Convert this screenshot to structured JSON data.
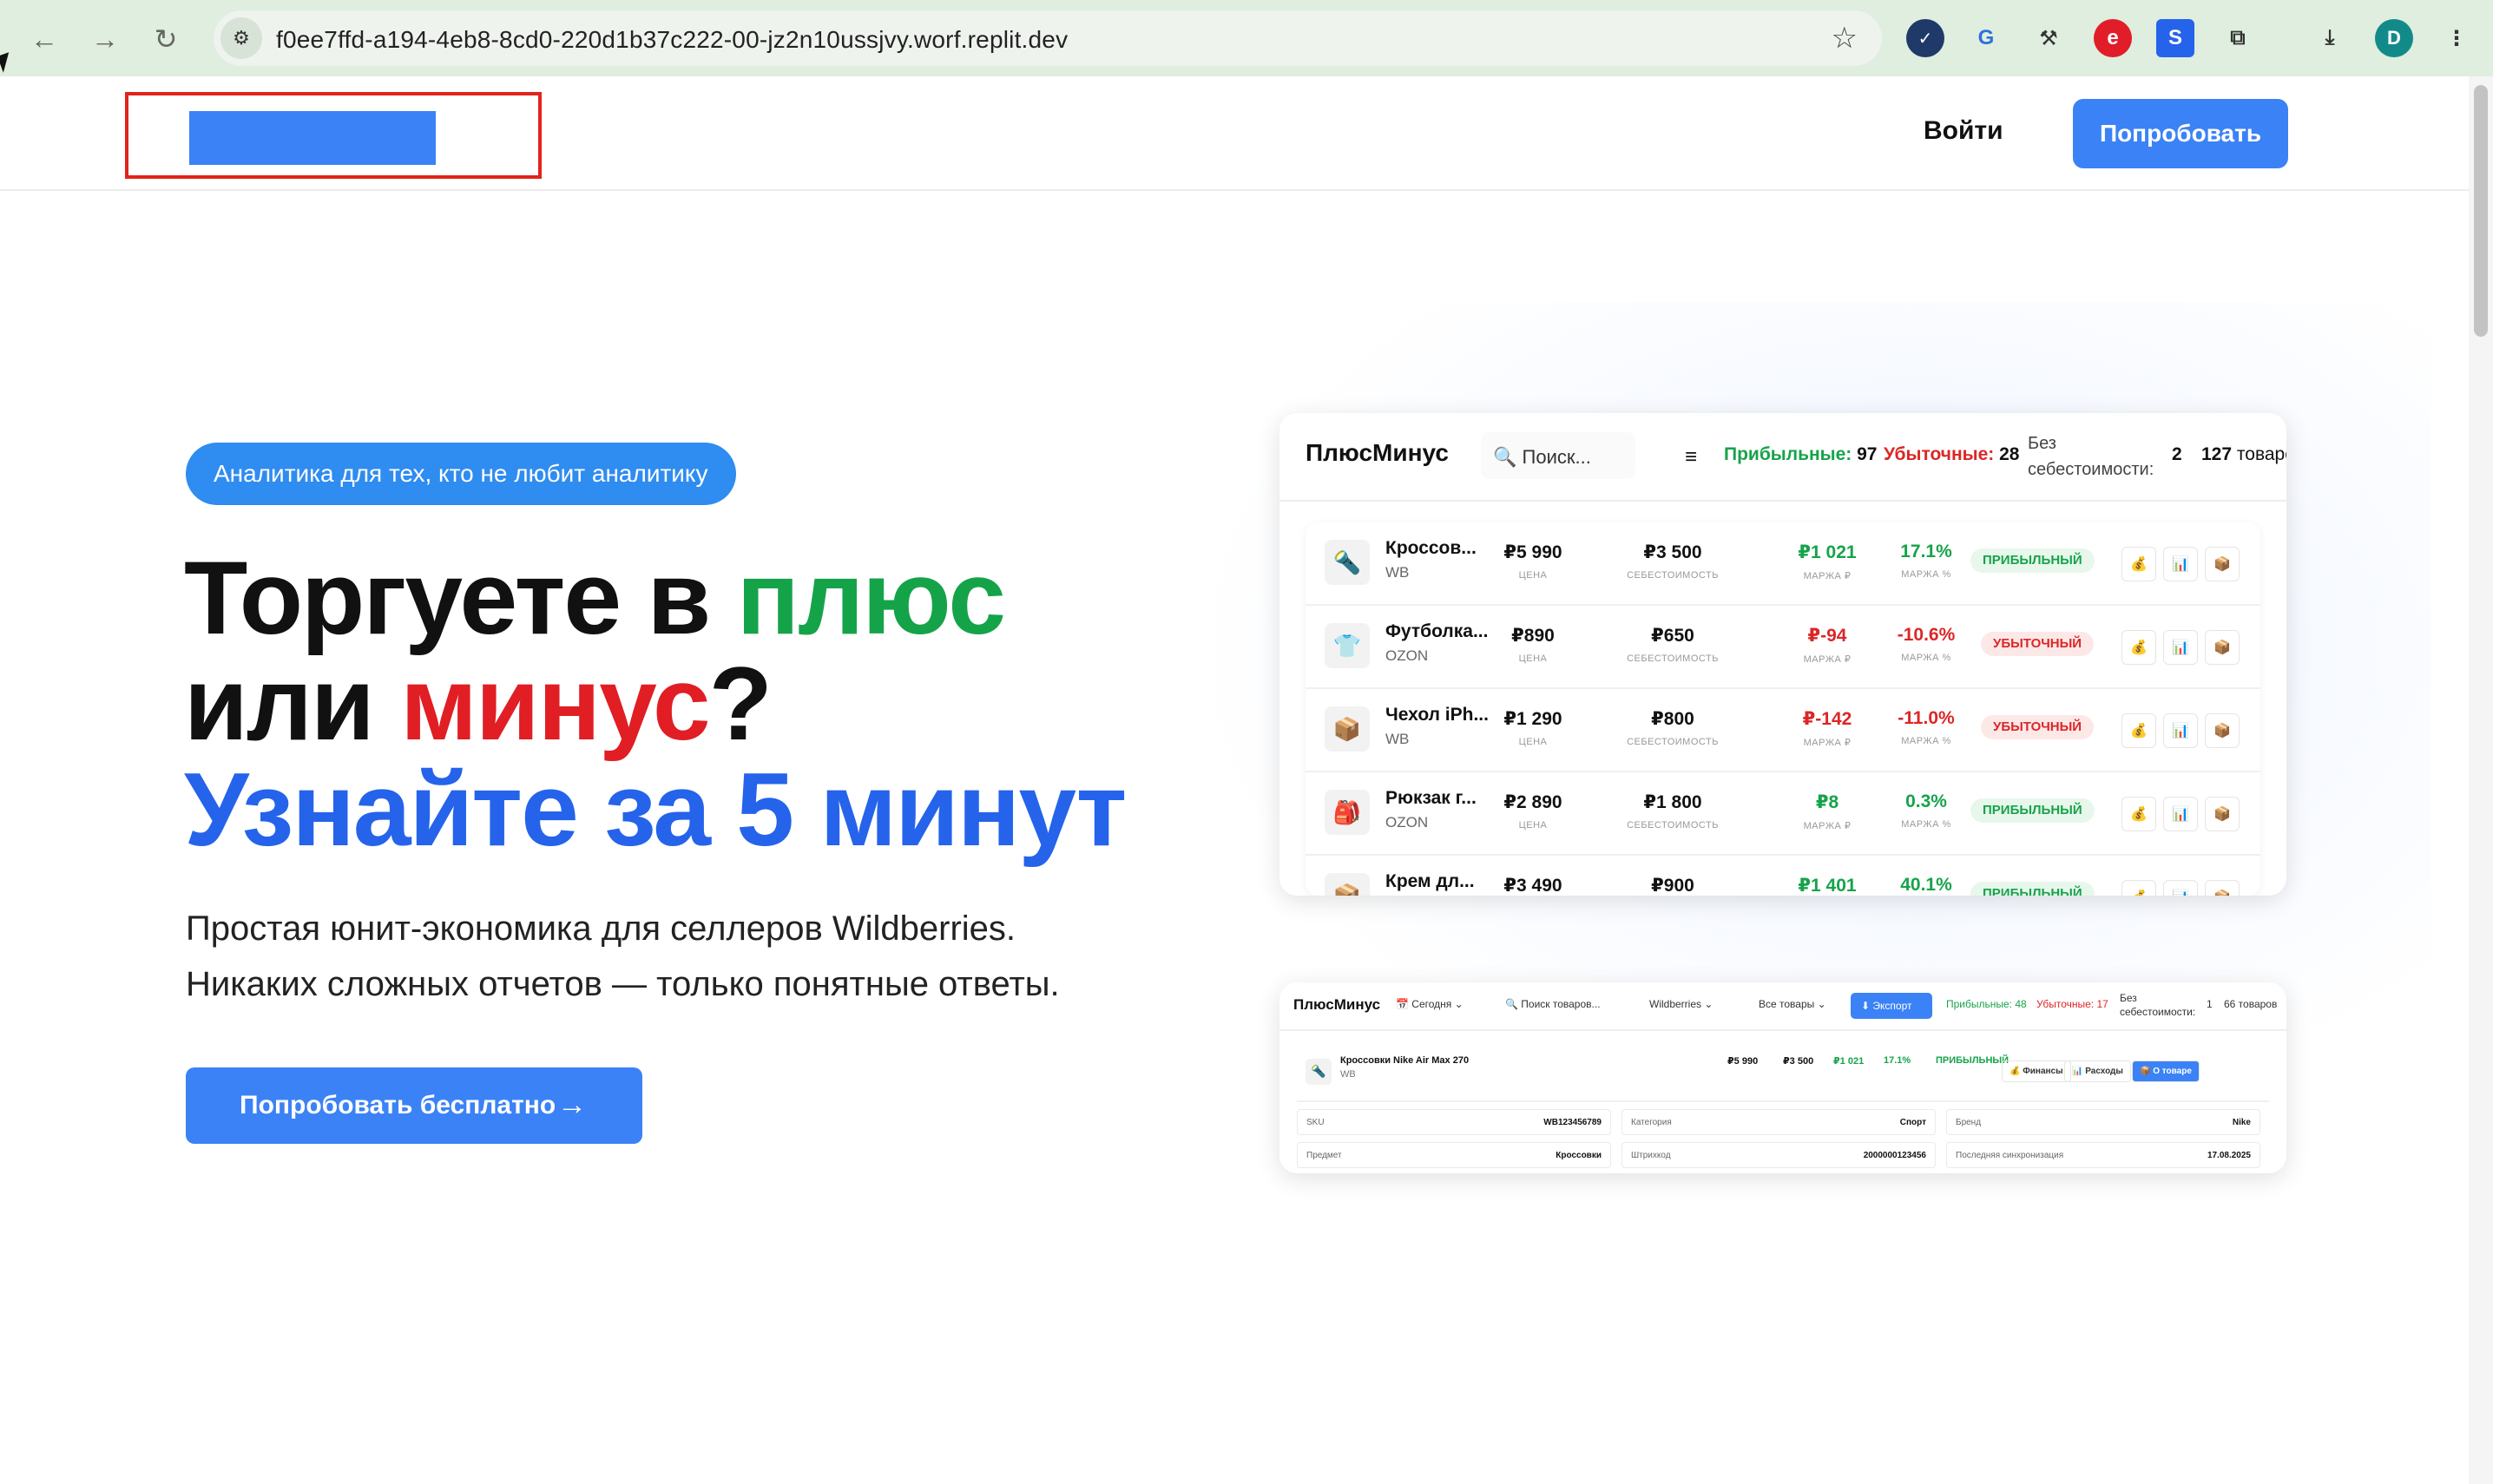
{
  "browser": {
    "url": "f0ee7ffd-a194-4eb8-8cd0-220d1b37c222-00-jz2n10ussjvy.worf.replit.dev",
    "profile_initial": "D"
  },
  "header": {
    "login_label": "Войти",
    "try_label": "Попробовать"
  },
  "hero": {
    "badge": "Аналитика для тех, кто не любит аналитику",
    "title_part1": "Торгуете в ",
    "title_green": "плюс",
    "title_part2": "или ",
    "title_red": "минус",
    "title_q": "?",
    "title_blue": "Узнайте за 5 минут",
    "subtitle_line1": "Простая юнит-экономика для селлеров Wildberries.",
    "subtitle_line2": "Никаких сложных отчетов — только понятные ответы.",
    "cta_label": "Попробовать бесплатно",
    "cta_arrow": "→"
  },
  "mock1": {
    "brand": "ПлюсМинус",
    "search_placeholder": "Поиск...",
    "menu_icon": "≡",
    "profitable_label": "Прибыльные:",
    "profitable_count": "97",
    "loss_label": "Убыточные:",
    "loss_count": "28",
    "nocost_label_1": "Без",
    "nocost_label_2": "себестоимости:",
    "nocost_count": "2",
    "total_count": "127",
    "total_label": "товаров",
    "col_price": "ЦЕНА",
    "col_cost": "СЕБЕСТОИМОСТЬ",
    "col_margin_rub": "МАРЖА ₽",
    "col_margin_pct": "МАРЖА %",
    "rows": [
      {
        "icon": "🔦",
        "name": "Кроссов...",
        "mp": "WB",
        "price": "₽5 990",
        "cost": "₽3 500",
        "margin": "₽1 021",
        "pct": "17.1%",
        "status": "ПРИБЫЛЬНЫЙ",
        "positive": true
      },
      {
        "icon": "👕",
        "name": "Футболка...",
        "mp": "OZON",
        "price": "₽890",
        "cost": "₽650",
        "margin": "₽-94",
        "pct": "-10.6%",
        "status": "УБЫТОЧНЫЙ",
        "positive": false
      },
      {
        "icon": "📦",
        "name": "Чехол iPh...",
        "mp": "WB",
        "price": "₽1 290",
        "cost": "₽800",
        "margin": "₽-142",
        "pct": "-11.0%",
        "status": "УБЫТОЧНЫЙ",
        "positive": false
      },
      {
        "icon": "🎒",
        "name": "Рюкзак г...",
        "mp": "OZON",
        "price": "₽2 890",
        "cost": "₽1 800",
        "margin": "₽8",
        "pct": "0.3%",
        "status": "ПРИБЫЛЬНЫЙ",
        "positive": true
      },
      {
        "icon": "📦",
        "name": "Крем дл...",
        "mp": "WB",
        "price": "₽3 490",
        "cost": "₽900",
        "margin": "₽1 401",
        "pct": "40.1%",
        "status": "ПРИБЫЛЬНЫЙ",
        "positive": true
      }
    ],
    "actions": [
      "💰",
      "📊",
      "📦"
    ]
  },
  "mock2": {
    "brand": "ПлюсМинус",
    "period": "📅 Сегодня ⌄",
    "search": "🔍 Поиск товаров...",
    "marketplace": "Wildberries ⌄",
    "filter": "Все товары ⌄",
    "export": "⬇ Экспорт",
    "profitable": "Прибыльные: 48",
    "loss": "Убыточные: 17",
    "nocost": "Без себестоимости:",
    "nocost_count": "1",
    "total": "66 товаров",
    "product": {
      "name": "Кроссовки Nike Air Max 270",
      "mp": "WB",
      "price": "₽5 990",
      "cost": "₽3 500",
      "margin": "₽1 021",
      "pct": "17.1%",
      "status": "ПРИБЫЛЬНЫЙ",
      "finance": "💰 Финансы",
      "expenses": "📊 Расходы",
      "about": "📦 О товаре"
    },
    "details": [
      {
        "k": "SKU",
        "v": "WB123456789"
      },
      {
        "k": "Категория",
        "v": "Спорт"
      },
      {
        "k": "Бренд",
        "v": "Nike"
      },
      {
        "k": "Предмет",
        "v": "Кроссовки"
      },
      {
        "k": "Штрихкод",
        "v": "2000000123456"
      },
      {
        "k": "Последняя синхронизация",
        "v": "17.08.2025"
      }
    ]
  }
}
